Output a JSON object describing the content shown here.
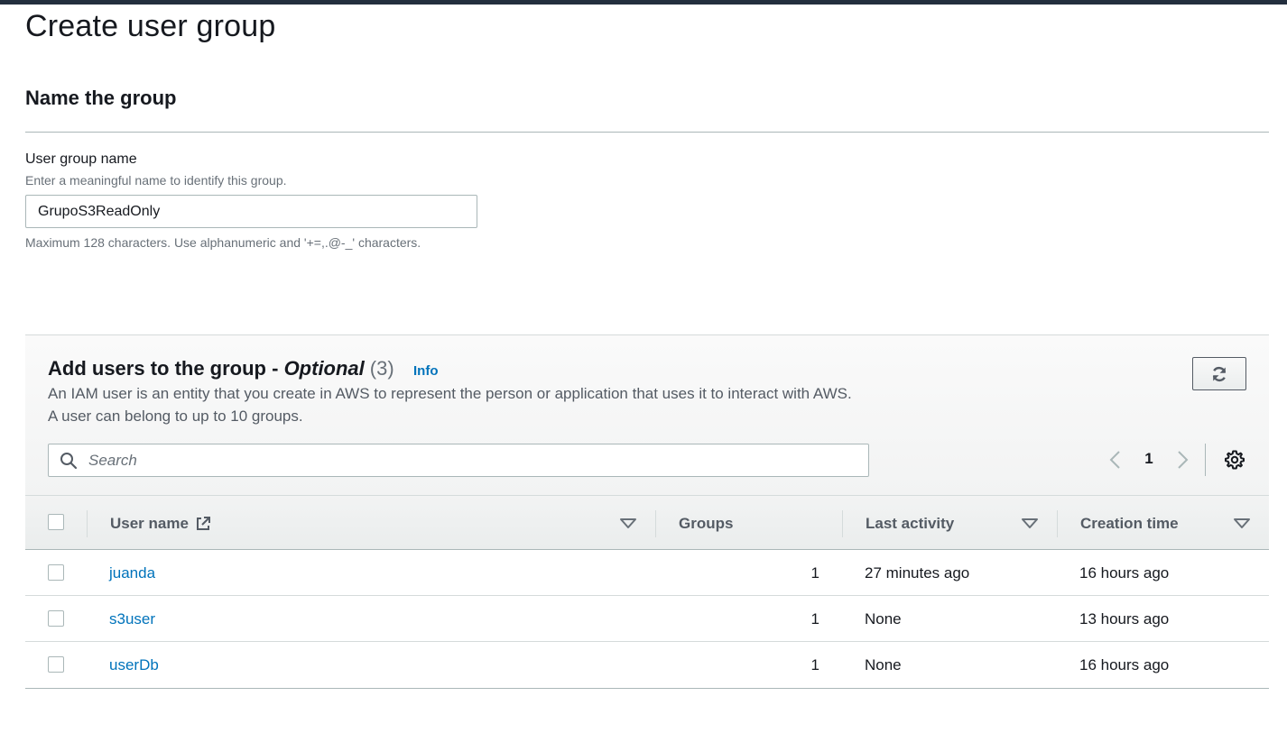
{
  "page": {
    "title": "Create user group"
  },
  "name_section": {
    "title": "Name the group",
    "field_label": "User group name",
    "field_description": "Enter a meaningful name to identify this group.",
    "field_value": "GrupoS3ReadOnly",
    "field_constraint": "Maximum 128 characters. Use alphanumeric and '+=,.@-_' characters."
  },
  "users_section": {
    "title": "Add users to the group - ",
    "title_optional": "Optional",
    "count": "(3)",
    "info_label": "Info",
    "description": "An IAM user is an entity that you create in AWS to represent the person or application that uses it to interact with AWS. A user can belong to up to 10 groups.",
    "search_placeholder": "Search",
    "current_page": "1",
    "icons": {
      "refresh": "refresh-icon",
      "search": "search-icon",
      "prev": "chevron-left-icon",
      "next": "chevron-right-icon",
      "settings": "gear-icon",
      "external": "external-link-icon",
      "sort": "caret-down-icon"
    }
  },
  "table": {
    "columns": [
      "User name",
      "Groups",
      "Last activity",
      "Creation time"
    ],
    "rows": [
      {
        "user_name": "juanda",
        "groups": "1",
        "last_activity": "27 minutes ago",
        "creation_time": "16 hours ago"
      },
      {
        "user_name": "s3user",
        "groups": "1",
        "last_activity": "None",
        "creation_time": "13 hours ago"
      },
      {
        "user_name": "userDb",
        "groups": "1",
        "last_activity": "None",
        "creation_time": "16 hours ago"
      }
    ]
  },
  "colors": {
    "link": "#0073bb",
    "topbar": "#232f3e",
    "text": "#16191f",
    "secondary_text": "#687078"
  }
}
